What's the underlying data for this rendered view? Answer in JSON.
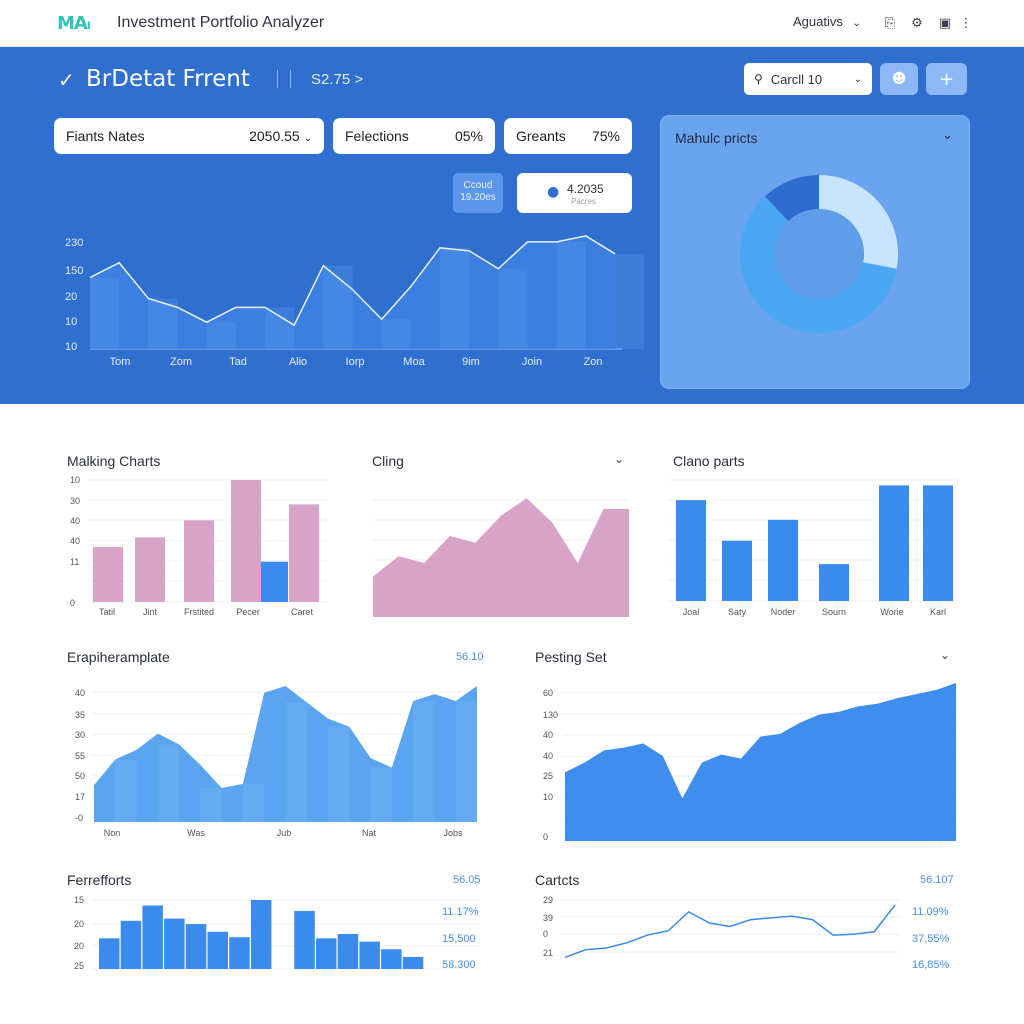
{
  "topbar": {
    "logo": "MAₗ",
    "title": "Investment Portfolio Analyzer",
    "account": "Aguativs",
    "icons": [
      "clipboard-icon",
      "gear-icon",
      "window-icon",
      "more-icon"
    ]
  },
  "hero": {
    "title": "BrDetat Frrent",
    "subtitle": "S2.75 >",
    "search_value": "Carcll 10",
    "stats": [
      {
        "label": "Fiants Nates",
        "value": "2050.55"
      },
      {
        "label": "Felections",
        "value": "05%"
      },
      {
        "label": "Greants",
        "value": "75%"
      }
    ],
    "tag_line1": "Ccoud",
    "tag_line2": "19.20es",
    "card_value": "4.2035",
    "card_sub": "Pacres"
  },
  "donut_title": "Mahulc pricts",
  "panels": {
    "p1_title": "Malking Charts",
    "p2_title": "Cling",
    "p3_title": "Clano parts",
    "p4_title": "Erapiheramplate",
    "p4_value": "56.10",
    "p5_title": "Pesting Set",
    "p6_title": "Ferrefforts",
    "p6_value": "56.05",
    "p6_side": [
      "11.17%",
      "15,500",
      "58,300"
    ],
    "p7_title": "Cartcts",
    "p7_value": "56.107",
    "p7_side": [
      "11.09%",
      "37,55%",
      "16,85%"
    ]
  },
  "colors": {
    "band": "#2f6fd0",
    "bar_blue": "#3b8bec",
    "pink": "#d9a3c8",
    "light_blue": "#5aa5f0"
  },
  "chart_data": [
    {
      "type": "area",
      "yticks": [
        "230",
        "150",
        "20",
        "10",
        "10"
      ],
      "categories": [
        "Tom",
        "Zom",
        "Tad",
        "Alio",
        "Iorp",
        "Moa",
        "9im",
        "Join",
        "Zon"
      ],
      "values": [
        120,
        145,
        85,
        70,
        45,
        70,
        70,
        40,
        140,
        100,
        50,
        105,
        170,
        165,
        135,
        180,
        180,
        190,
        160
      ]
    },
    {
      "type": "pie",
      "values": [
        12,
        28,
        60
      ],
      "colors": [
        "#2d6ccf",
        "#c6e4fb",
        "#4aa7f4"
      ]
    },
    {
      "type": "bar",
      "yticks": [
        "10",
        "30",
        "40",
        "40",
        "11",
        "0"
      ],
      "categories": [
        "Tatil",
        "Jint",
        "Frstited",
        "Pecer",
        "Caret"
      ],
      "values": [
        45,
        53,
        67,
        100,
        80
      ],
      "highlight": {
        "index": 3,
        "value": 33
      }
    },
    {
      "type": "area",
      "values": [
        30,
        45,
        40,
        60,
        55,
        75,
        88,
        70,
        40,
        80,
        80
      ]
    },
    {
      "type": "bar",
      "categories": [
        "Joal",
        "Saty",
        "Noder",
        "Sourn",
        "Worie",
        "Karl"
      ],
      "values": [
        82,
        49,
        66,
        30,
        94,
        94
      ]
    },
    {
      "type": "area",
      "yticks": [
        "40",
        "35",
        "30",
        "55",
        "50",
        "17",
        "-0"
      ],
      "categories": [
        "Non",
        "Was",
        "Jub",
        "Nat",
        "Jobs"
      ],
      "values": [
        27,
        46,
        53,
        65,
        57,
        42,
        25,
        28,
        95,
        100,
        88,
        76,
        70,
        47,
        40,
        89,
        94,
        89,
        100
      ]
    },
    {
      "type": "area",
      "yticks": [
        "60",
        "130",
        "40",
        "40",
        "25",
        "10",
        "0"
      ],
      "values": [
        50,
        57,
        66,
        68,
        71,
        62,
        31,
        57,
        63,
        60,
        76,
        78,
        86,
        92,
        94,
        98,
        100,
        104,
        107,
        110,
        115
      ]
    },
    {
      "type": "bar",
      "yticks": [
        "15",
        "20",
        "20",
        "25"
      ],
      "values": [
        28,
        44,
        58,
        46,
        41,
        34,
        29,
        63,
        0,
        53,
        28,
        32,
        25,
        18,
        11
      ]
    },
    {
      "type": "line",
      "yticks": [
        "29",
        "39",
        "0",
        "21"
      ],
      "values": [
        3,
        12,
        14,
        20,
        29,
        34,
        56,
        43,
        39,
        47,
        49,
        51,
        47,
        29,
        30,
        33,
        64
      ]
    }
  ]
}
